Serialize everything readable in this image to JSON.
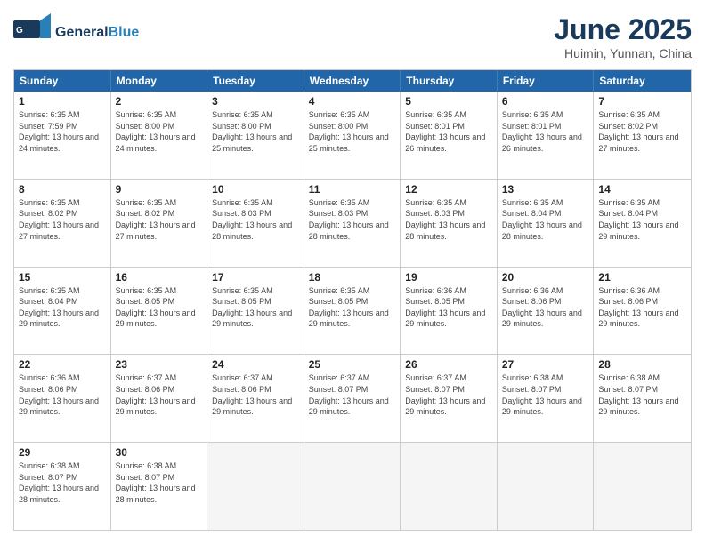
{
  "header": {
    "logo_general": "General",
    "logo_blue": "Blue",
    "title": "June 2025",
    "subtitle": "Huimin, Yunnan, China"
  },
  "calendar": {
    "days_of_week": [
      "Sunday",
      "Monday",
      "Tuesday",
      "Wednesday",
      "Thursday",
      "Friday",
      "Saturday"
    ],
    "weeks": [
      [
        {
          "day": "",
          "empty": true
        },
        {
          "day": "",
          "empty": true
        },
        {
          "day": "",
          "empty": true
        },
        {
          "day": "",
          "empty": true
        },
        {
          "day": "",
          "empty": true
        },
        {
          "day": "",
          "empty": true
        },
        {
          "day": "",
          "empty": true
        }
      ],
      [
        {
          "day": "1",
          "rise": "6:35 AM",
          "set": "7:59 PM",
          "daylight": "13 hours and 24 minutes."
        },
        {
          "day": "2",
          "rise": "6:35 AM",
          "set": "8:00 PM",
          "daylight": "13 hours and 24 minutes."
        },
        {
          "day": "3",
          "rise": "6:35 AM",
          "set": "8:00 PM",
          "daylight": "13 hours and 25 minutes."
        },
        {
          "day": "4",
          "rise": "6:35 AM",
          "set": "8:00 PM",
          "daylight": "13 hours and 25 minutes."
        },
        {
          "day": "5",
          "rise": "6:35 AM",
          "set": "8:01 PM",
          "daylight": "13 hours and 26 minutes."
        },
        {
          "day": "6",
          "rise": "6:35 AM",
          "set": "8:01 PM",
          "daylight": "13 hours and 26 minutes."
        },
        {
          "day": "7",
          "rise": "6:35 AM",
          "set": "8:02 PM",
          "daylight": "13 hours and 27 minutes."
        }
      ],
      [
        {
          "day": "8",
          "rise": "6:35 AM",
          "set": "8:02 PM",
          "daylight": "13 hours and 27 minutes."
        },
        {
          "day": "9",
          "rise": "6:35 AM",
          "set": "8:02 PM",
          "daylight": "13 hours and 27 minutes."
        },
        {
          "day": "10",
          "rise": "6:35 AM",
          "set": "8:03 PM",
          "daylight": "13 hours and 28 minutes."
        },
        {
          "day": "11",
          "rise": "6:35 AM",
          "set": "8:03 PM",
          "daylight": "13 hours and 28 minutes."
        },
        {
          "day": "12",
          "rise": "6:35 AM",
          "set": "8:03 PM",
          "daylight": "13 hours and 28 minutes."
        },
        {
          "day": "13",
          "rise": "6:35 AM",
          "set": "8:04 PM",
          "daylight": "13 hours and 28 minutes."
        },
        {
          "day": "14",
          "rise": "6:35 AM",
          "set": "8:04 PM",
          "daylight": "13 hours and 29 minutes."
        }
      ],
      [
        {
          "day": "15",
          "rise": "6:35 AM",
          "set": "8:04 PM",
          "daylight": "13 hours and 29 minutes."
        },
        {
          "day": "16",
          "rise": "6:35 AM",
          "set": "8:05 PM",
          "daylight": "13 hours and 29 minutes."
        },
        {
          "day": "17",
          "rise": "6:35 AM",
          "set": "8:05 PM",
          "daylight": "13 hours and 29 minutes."
        },
        {
          "day": "18",
          "rise": "6:35 AM",
          "set": "8:05 PM",
          "daylight": "13 hours and 29 minutes."
        },
        {
          "day": "19",
          "rise": "6:36 AM",
          "set": "8:05 PM",
          "daylight": "13 hours and 29 minutes."
        },
        {
          "day": "20",
          "rise": "6:36 AM",
          "set": "8:06 PM",
          "daylight": "13 hours and 29 minutes."
        },
        {
          "day": "21",
          "rise": "6:36 AM",
          "set": "8:06 PM",
          "daylight": "13 hours and 29 minutes."
        }
      ],
      [
        {
          "day": "22",
          "rise": "6:36 AM",
          "set": "8:06 PM",
          "daylight": "13 hours and 29 minutes."
        },
        {
          "day": "23",
          "rise": "6:37 AM",
          "set": "8:06 PM",
          "daylight": "13 hours and 29 minutes."
        },
        {
          "day": "24",
          "rise": "6:37 AM",
          "set": "8:06 PM",
          "daylight": "13 hours and 29 minutes."
        },
        {
          "day": "25",
          "rise": "6:37 AM",
          "set": "8:07 PM",
          "daylight": "13 hours and 29 minutes."
        },
        {
          "day": "26",
          "rise": "6:37 AM",
          "set": "8:07 PM",
          "daylight": "13 hours and 29 minutes."
        },
        {
          "day": "27",
          "rise": "6:38 AM",
          "set": "8:07 PM",
          "daylight": "13 hours and 29 minutes."
        },
        {
          "day": "28",
          "rise": "6:38 AM",
          "set": "8:07 PM",
          "daylight": "13 hours and 29 minutes."
        }
      ],
      [
        {
          "day": "29",
          "rise": "6:38 AM",
          "set": "8:07 PM",
          "daylight": "13 hours and 28 minutes."
        },
        {
          "day": "30",
          "rise": "6:38 AM",
          "set": "8:07 PM",
          "daylight": "13 hours and 28 minutes."
        },
        {
          "day": "",
          "empty": true
        },
        {
          "day": "",
          "empty": true
        },
        {
          "day": "",
          "empty": true
        },
        {
          "day": "",
          "empty": true
        },
        {
          "day": "",
          "empty": true
        }
      ]
    ]
  }
}
